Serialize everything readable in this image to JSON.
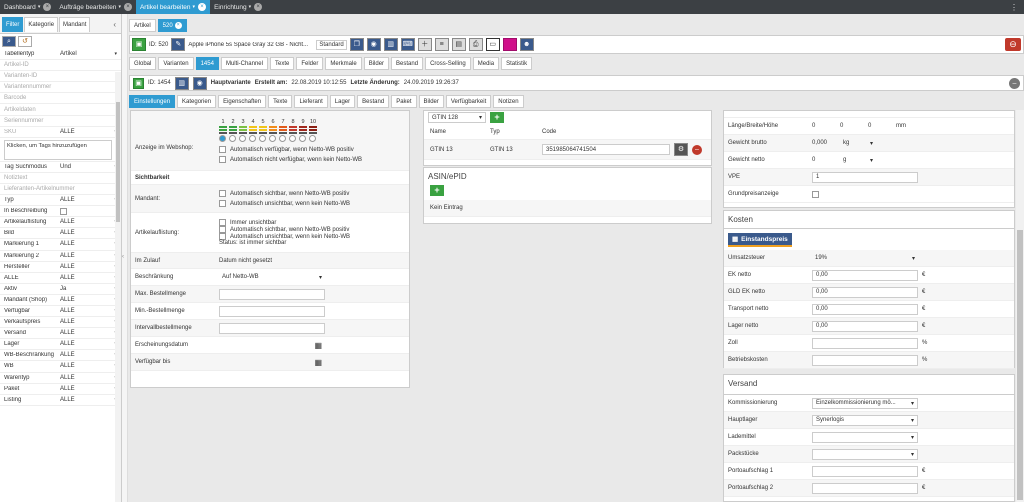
{
  "topbar": {
    "tabs": [
      {
        "label": "Dashboard",
        "caret": "▾",
        "close": "×",
        "active": false
      },
      {
        "label": "Aufträge bearbeiten",
        "caret": "▾",
        "close": "×",
        "active": false
      },
      {
        "label": "Artikel bearbeiten",
        "caret": "▾",
        "close": "×",
        "active": true
      },
      {
        "label": "Einrichtung",
        "caret": "▾",
        "close": "×",
        "active": false
      }
    ],
    "menu": "⋮"
  },
  "left": {
    "tabs": [
      "Filter",
      "Kategorie",
      "Mandant"
    ],
    "collapse": "‹",
    "tool_search": "⌕",
    "tool_reset": "↺",
    "tabellentyp_label": "Tabellentyp",
    "tabellentyp_value": "Artikel",
    "placeholders": [
      "Artikel-ID",
      "Varianten-ID",
      "Variantennummer",
      "Barcode",
      "Artikeldaten",
      "Seriennummer"
    ],
    "sku_label": "SKU",
    "sku_value": "ALLE",
    "tags_placeholder": "Klicken, um Tags hinzuzufügen",
    "tagmodus_label": "Tag Suchmodus",
    "tagmodus_value": "Und",
    "notiz_placeholder": "Notiztext",
    "lieferant_placeholder": "Lieferanten-Artikelnummer",
    "filters": [
      {
        "label": "Typ",
        "value": "ALLE"
      },
      {
        "label": "In Beschreibung",
        "value": ""
      },
      {
        "label": "Artikelauflistung",
        "value": "ALLE"
      },
      {
        "label": "Bild",
        "value": "ALLE"
      },
      {
        "label": "Markierung 1",
        "value": "ALLE"
      },
      {
        "label": "Markierung 2",
        "value": "ALLE"
      },
      {
        "label": "Hersteller",
        "value": "ALLE"
      },
      {
        "label": "ALLE",
        "value": "ALLE"
      },
      {
        "label": "Aktiv",
        "value": "Ja"
      },
      {
        "label": "Mandant (Shop)",
        "value": "ALLE"
      },
      {
        "label": "Verfügbar",
        "value": "ALLE"
      },
      {
        "label": "Verkaufspreis",
        "value": "ALLE"
      },
      {
        "label": "Versand",
        "value": "ALLE"
      },
      {
        "label": "Lager",
        "value": "ALLE"
      },
      {
        "label": "WB-Beschränkung",
        "value": "ALLE"
      },
      {
        "label": "WB",
        "value": "ALLE"
      },
      {
        "label": "Warentyp",
        "value": "ALLE"
      },
      {
        "label": "Paket",
        "value": "ALLE"
      },
      {
        "label": "Listing",
        "value": "ALLE"
      }
    ]
  },
  "main": {
    "tabs": [
      "Artikel",
      "520"
    ],
    "toolbar": {
      "id_text": "ID: 520",
      "title": "Apple iPhone 5s Space Gray 32 GB - Nicht...",
      "type": "Standard"
    },
    "tabs1": [
      "Global",
      "Varianten",
      "1454",
      "Multi-Channel",
      "Texte",
      "Felder",
      "Merkmale",
      "Bilder",
      "Bestand",
      "Cross-Selling",
      "Media",
      "Statistik"
    ],
    "varbar": {
      "id": "ID: 1454",
      "hauptvariante": "Hauptvariante",
      "erstellt": "Erstellt am:",
      "erstellt_value": "22.08.2019 10:12:55",
      "aenderung": "Letzte Änderung:",
      "aenderung_value": "24.09.2019 19:26:37"
    },
    "tabs2": [
      "Einstellungen",
      "Kategorien",
      "Eigenschaften",
      "Texte",
      "Lieferant",
      "Lager",
      "Bestand",
      "Paket",
      "Bilder",
      "Verfügbarkeit",
      "Notizen"
    ]
  },
  "settings": {
    "webshop_label": "Anzeige im Webshop:",
    "levels": [
      "1",
      "2",
      "3",
      "4",
      "5",
      "6",
      "7",
      "8",
      "9",
      "10"
    ],
    "level_colors": [
      "#3aa241",
      "#3aa241",
      "#7bc043",
      "#f0c419",
      "#f0c419",
      "#f08c1a",
      "#e05a1a",
      "#c0392b",
      "#a0281d",
      "#8a1f14"
    ],
    "cb_auto_verf": "Automatisch verfügbar, wenn Netto-WB positiv",
    "cb_auto_nicht": "Automatisch nicht verfügbar, wenn kein Netto-WB",
    "sichtbarkeit": "Sichtbarkeit",
    "mandant_label": "Mandant:",
    "cb_sichtbar": "Automatisch sichtbar, wenn Netto-WB positiv",
    "cb_unsichtbar": "Automatisch unsichtbar, wenn kein Netto-WB",
    "artikelauf_label": "Artikelauflistung:",
    "cb_immer": "Immer unsichtbar",
    "cb_auf_sichtbar": "Automatisch sichtbar, wenn Netto-WB positiv",
    "cb_auf_unsichtbar": "Automatisch unsichtbar, wenn kein Netto-WB",
    "status": "Status: ist immer sichtbar",
    "zulauf_label": "Im Zulauf",
    "zulauf_value": "Datum nicht gesetzt",
    "beschr_label": "Beschränkung",
    "beschr_value": "Auf Netto-WB",
    "maxbest": "Max. Bestellmenge",
    "minbest": "Min.-Bestellmenge",
    "intervall": "Intervallbestellmenge",
    "erscheinung": "Erscheinungsdatum",
    "verfbis": "Verfügbar bis"
  },
  "barcode": {
    "gtin_select": "GTIN 128",
    "headers": [
      "Name",
      "Typ",
      "Code"
    ],
    "row": {
      "name": "GTIN 13",
      "typ": "GTIN 13",
      "code": "351985064741504"
    },
    "asin_title": "ASIN/ePID",
    "kein": "Kein Eintrag"
  },
  "dims": {
    "lbh_label": "Länge/Breite/Höhe",
    "l": "0",
    "b": "0",
    "h": "0",
    "unit": "mm",
    "brutto_label": "Gewicht brutto",
    "brutto": "0,000",
    "brutto_unit": "kg",
    "netto_label": "Gewicht netto",
    "netto": "0",
    "netto_unit": "g",
    "vpe_label": "VPE",
    "vpe": "1",
    "grund_label": "Grundpreisanzeige"
  },
  "kosten": {
    "title": "Kosten",
    "badge": "Einstandspreis",
    "ust_label": "Umsatzsteuer",
    "ust": "19%",
    "rows": [
      {
        "label": "EK netto",
        "value": "0,00",
        "unit": "€"
      },
      {
        "label": "GLD EK netto",
        "value": "0,00",
        "unit": "€"
      },
      {
        "label": "Transport netto",
        "value": "0,00",
        "unit": "€"
      },
      {
        "label": "Lager netto",
        "value": "0,00",
        "unit": "€"
      },
      {
        "label": "Zoll",
        "value": "",
        "unit": "%"
      },
      {
        "label": "Betriebskosten",
        "value": "",
        "unit": "%"
      }
    ]
  },
  "versand": {
    "title": "Versand",
    "rows": [
      {
        "label": "Kommissionierung",
        "value": "Einzelkommissionierung mö...",
        "unit": ""
      },
      {
        "label": "Hauptlager",
        "value": "Synerlogis",
        "unit": ""
      },
      {
        "label": "Lademittel",
        "value": "",
        "unit": ""
      },
      {
        "label": "Packstücke",
        "value": "",
        "unit": ""
      },
      {
        "label": "Portoaufschlag 1",
        "value": "",
        "unit": "€"
      },
      {
        "label": "Portoaufschlag 2",
        "value": "",
        "unit": "€"
      }
    ]
  }
}
